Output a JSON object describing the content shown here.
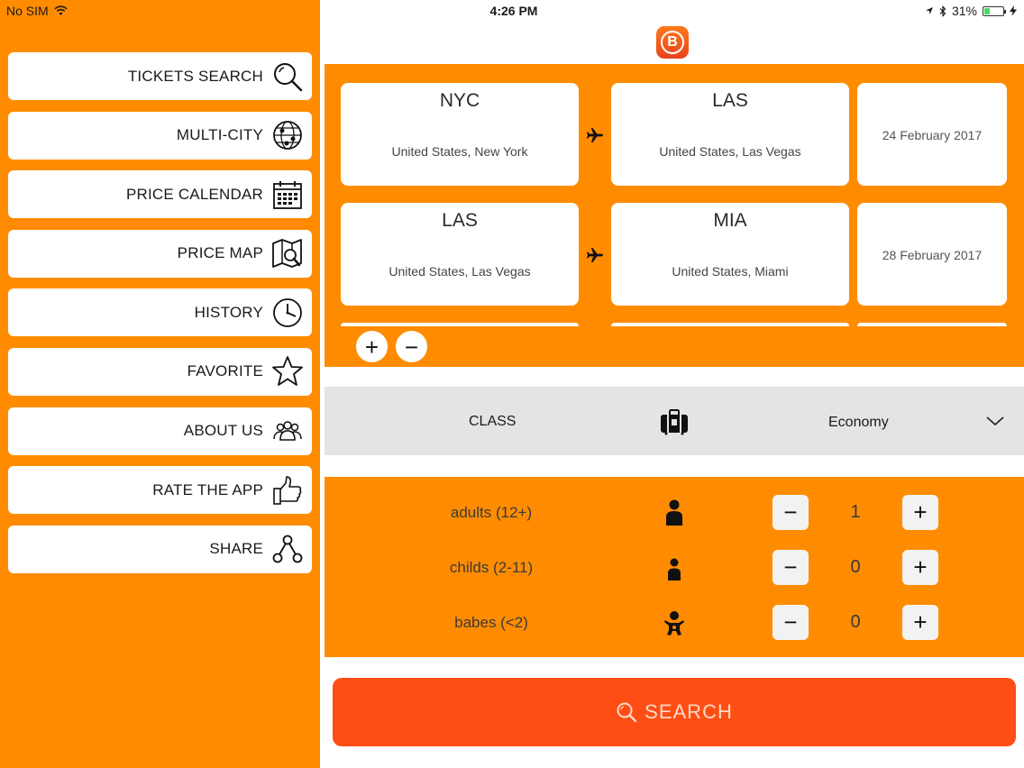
{
  "status_bar": {
    "carrier": "No SIM",
    "time": "4:26 PM",
    "battery": "31%"
  },
  "menu": {
    "items": [
      {
        "label": "TICKETS SEARCH",
        "icon": "magnifier-icon"
      },
      {
        "label": "MULTI-CITY",
        "icon": "globe-icon"
      },
      {
        "label": "PRICE CALENDAR",
        "icon": "calendar-icon"
      },
      {
        "label": "PRICE MAP",
        "icon": "map-search-icon"
      },
      {
        "label": "HISTORY",
        "icon": "clock-icon"
      },
      {
        "label": "FAVORITE",
        "icon": "star-icon"
      },
      {
        "label": "ABOUT US",
        "icon": "people-icon"
      },
      {
        "label": "RATE THE APP",
        "icon": "thumbs-up-icon"
      },
      {
        "label": "SHARE",
        "icon": "share-icon"
      }
    ]
  },
  "logo": {
    "letter": "B"
  },
  "routes": [
    {
      "from_code": "NYC",
      "from_place": "United States, New York",
      "to_code": "LAS",
      "to_place": "United States, Las Vegas",
      "date": "24 February 2017"
    },
    {
      "from_code": "LAS",
      "from_place": "United States, Las Vegas",
      "to_code": "MIA",
      "to_place": "United States, Miami",
      "date": "28 February 2017"
    }
  ],
  "route_controls": {
    "add": "+",
    "remove": "−"
  },
  "class_selector": {
    "label": "CLASS",
    "value": "Economy",
    "icon": "suitcase-icon"
  },
  "passengers": [
    {
      "label": "adults (12+)",
      "count": "1",
      "icon": "adult-icon"
    },
    {
      "label": "childs (2-11)",
      "count": "0",
      "icon": "child-icon"
    },
    {
      "label": "babes (<2)",
      "count": "0",
      "icon": "baby-icon"
    }
  ],
  "stepper": {
    "minus": "−",
    "plus": "+"
  },
  "search_button": {
    "label": "SEARCH"
  },
  "colors": {
    "brand_orange": "#FF8C00",
    "search_red": "#FF4E13",
    "class_bar_gray": "#E4E4E7"
  }
}
